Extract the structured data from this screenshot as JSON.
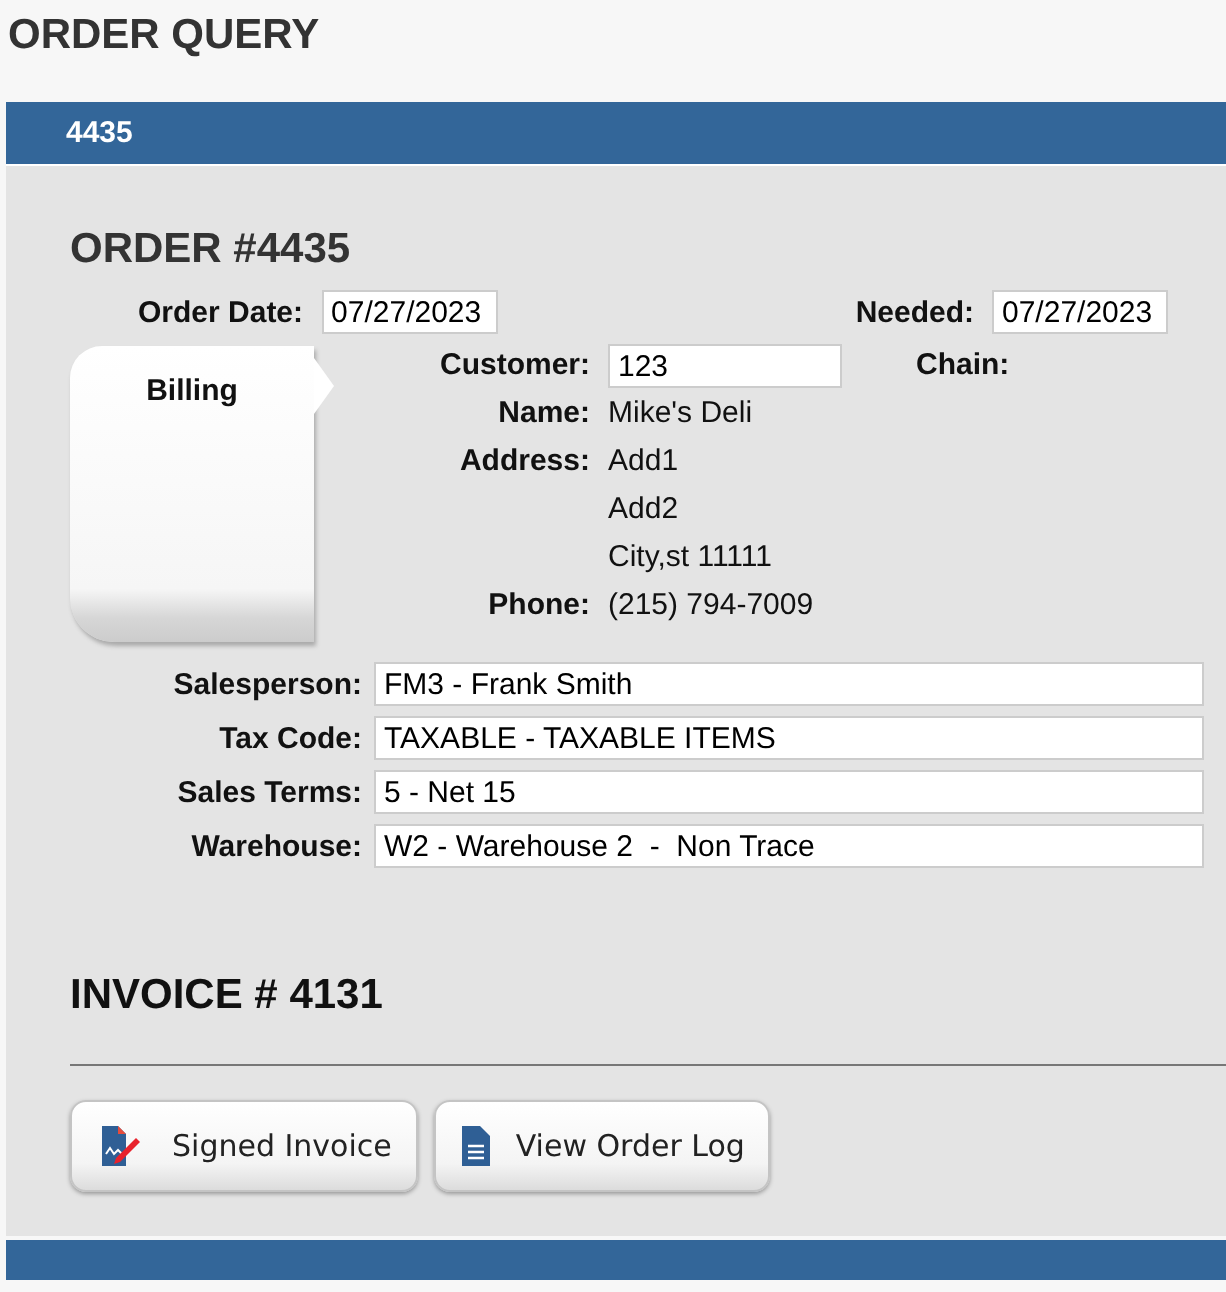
{
  "page_title": "ORDER QUERY",
  "tab_bar": {
    "label": "4435"
  },
  "order": {
    "heading": "ORDER #4435",
    "dates": [
      {
        "label": "Order Date:",
        "value": "07/27/2023"
      },
      {
        "label": "Needed:",
        "value": "07/27/2023"
      }
    ]
  },
  "billing_tab": {
    "label": "Billing"
  },
  "customer_fields": [
    {
      "kind": "input",
      "label": "Customer:",
      "lines": [
        "123"
      ]
    },
    {
      "kind": "text",
      "label": "Name:",
      "lines": [
        "Mike's Deli"
      ]
    },
    {
      "kind": "text",
      "label": "Address:",
      "lines": [
        "Add1",
        "Add2",
        "City,st 11111"
      ]
    },
    {
      "kind": "text",
      "label": "Phone:",
      "lines": [
        "(215) 794-7009"
      ]
    }
  ],
  "chain": {
    "label": "Chain:"
  },
  "details": [
    {
      "label": "Salesperson:",
      "value": "FM3 - Frank Smith"
    },
    {
      "label": "Tax Code:",
      "value": "TAXABLE - TAXABLE ITEMS"
    },
    {
      "label": "Sales Terms:",
      "value": "5 - Net 15"
    },
    {
      "label": "Warehouse:",
      "value": "W2 - Warehouse 2  -  Non Trace"
    }
  ],
  "invoice_heading": "INVOICE # 4131",
  "buttons": [
    {
      "kind": "signature",
      "label": "Signed Invoice"
    },
    {
      "kind": "document",
      "label": "View Order Log"
    }
  ]
}
